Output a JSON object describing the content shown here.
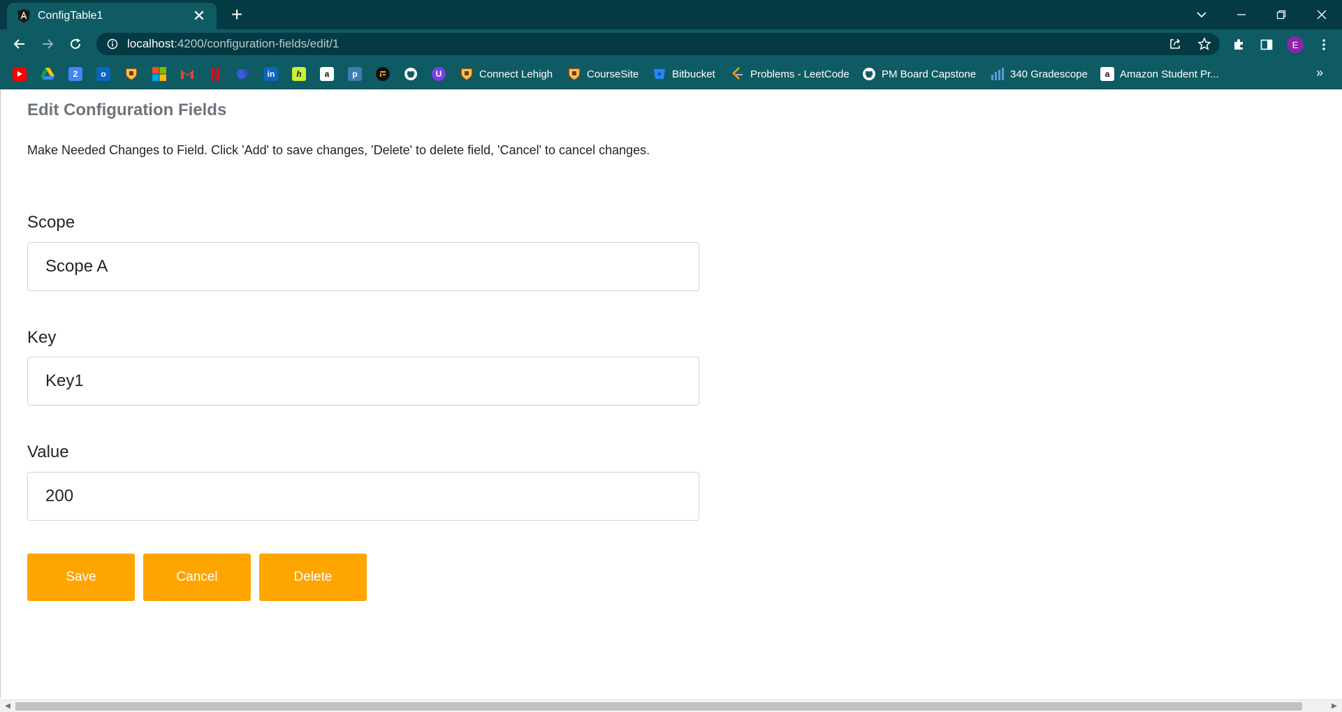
{
  "browser": {
    "tab_title": "ConfigTable1",
    "tab_close": "✕",
    "new_tab": "+",
    "url_host": "localhost",
    "url_path": ":4200/configuration-fields/edit/1",
    "avatar_letter": "E",
    "bookmarks_more": "»",
    "bookmarks": [
      {
        "label": "Connect Lehigh"
      },
      {
        "label": "CourseSite"
      },
      {
        "label": "Bitbucket"
      },
      {
        "label": "Problems - LeetCode"
      },
      {
        "label": "PM Board Capstone"
      },
      {
        "label": "340 Gradescope"
      },
      {
        "label": "Amazon Student Pr..."
      }
    ],
    "bookmark_icon_glyphs": {
      "calendar": "2",
      "outlook": "o",
      "linkedin": "in",
      "handshake": "h",
      "amazon": "a",
      "piazza": "p",
      "upwork": "U"
    }
  },
  "page": {
    "title": "Edit Configuration Fields",
    "description": "Make Needed Changes to Field. Click 'Add' to save changes, 'Delete' to delete field, 'Cancel' to cancel changes.",
    "fields": {
      "scope": {
        "label": "Scope",
        "value": "Scope A"
      },
      "key": {
        "label": "Key",
        "value": "Key1"
      },
      "value": {
        "label": "Value",
        "value": "200"
      }
    },
    "buttons": {
      "save": "Save",
      "cancel": "Cancel",
      "delete": "Delete"
    }
  },
  "colors": {
    "accent_button": "#ffa500",
    "title_gray": "#6c757d",
    "chrome_dark": "#043a44",
    "chrome_toolbar": "#0e5b63"
  }
}
